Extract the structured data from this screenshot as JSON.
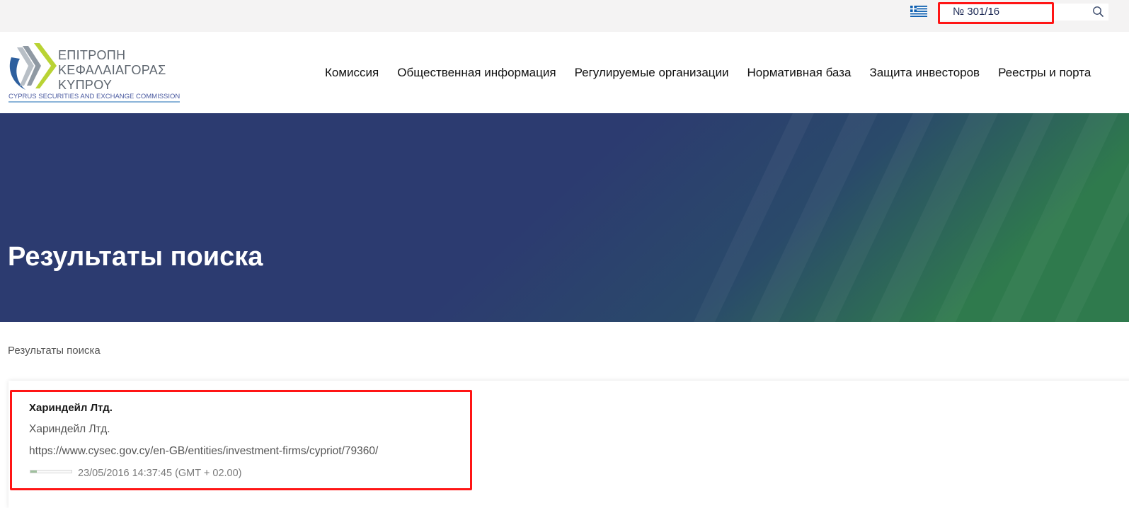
{
  "colors": {
    "topbar_bg": "#f4f3f3",
    "hero_navy": "#2c3b70",
    "hero_green": "#2f7a4d",
    "highlight_red": "#ff1515",
    "logo_grey": "#5f6770",
    "logo_blue": "#4a5aa0"
  },
  "topbar": {
    "language_icon": "greek-flag-icon",
    "search": {
      "value": "№ 301/16",
      "icon": "search-icon"
    }
  },
  "logo": {
    "line1": "ΕΠΙΤΡΟΠΗ",
    "line2": "ΚΕΦΑΛΑΙΑΓΟΡΑΣ",
    "line3": "ΚΥΠΡΟΥ",
    "subtitle": "CYPRUS SECURITIES AND EXCHANGE COMMISSION"
  },
  "nav": {
    "items": [
      {
        "label": "Комиссия"
      },
      {
        "label": "Общественная информация"
      },
      {
        "label": "Регулируемые организации"
      },
      {
        "label": "Нормативная база"
      },
      {
        "label": "Защита инвесторов"
      },
      {
        "label": "Реестры и порта"
      }
    ]
  },
  "hero": {
    "title": "Результаты поиска"
  },
  "breadcrumb": {
    "label": "Результаты поиска"
  },
  "results": [
    {
      "title": "Хариндейл Лтд.",
      "description": "Хариндейл Лтд.",
      "url": "https://www.cysec.gov.cy/en-GB/entities/investment-firms/cypriot/79360/",
      "date": "23/05/2016 14:37:45 (GMT + 02.00)",
      "relevance": 0.15
    }
  ]
}
